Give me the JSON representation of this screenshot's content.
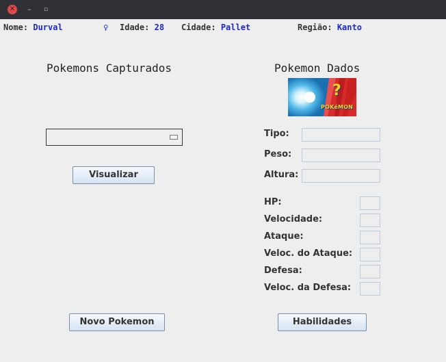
{
  "window": {
    "controls": {
      "close": "✕",
      "minimize": "–",
      "maximize": "▫"
    }
  },
  "trainer": {
    "nome_label": "Nome:",
    "nome": "Durval",
    "gender_symbol": "♀",
    "idade_label": "Idade:",
    "idade": "28",
    "cidade_label": "Cidade:",
    "cidade": "Pallet",
    "regiao_label": "Região:",
    "regiao": "Kanto"
  },
  "left_panel": {
    "title": "Pokemons Capturados",
    "combo_value": "",
    "visualizar_button": "Visualizar",
    "novo_pokemon_button": "Novo Pokemon"
  },
  "right_panel": {
    "title": "Pokemon Dados",
    "image_question_mark": "?",
    "image_logo_text": "POKéMON",
    "fields": {
      "tipo_label": "Tipo:",
      "tipo": "",
      "peso_label": "Peso:",
      "peso": "",
      "altura_label": "Altura:",
      "altura": ""
    },
    "stats": {
      "hp_label": "HP:",
      "velocidade_label": "Velocidade:",
      "ataque_label": "Ataque:",
      "veloc_ataque_label": "Veloc. do Ataque:",
      "defesa_label": "Defesa:",
      "veloc_defesa_label": "Veloc. da Defesa:"
    },
    "habilidades_button": "Habilidades"
  },
  "colors": {
    "value_text": "#1d29c9",
    "background": "#eeeeee",
    "button_border": "#7a8ea8"
  }
}
